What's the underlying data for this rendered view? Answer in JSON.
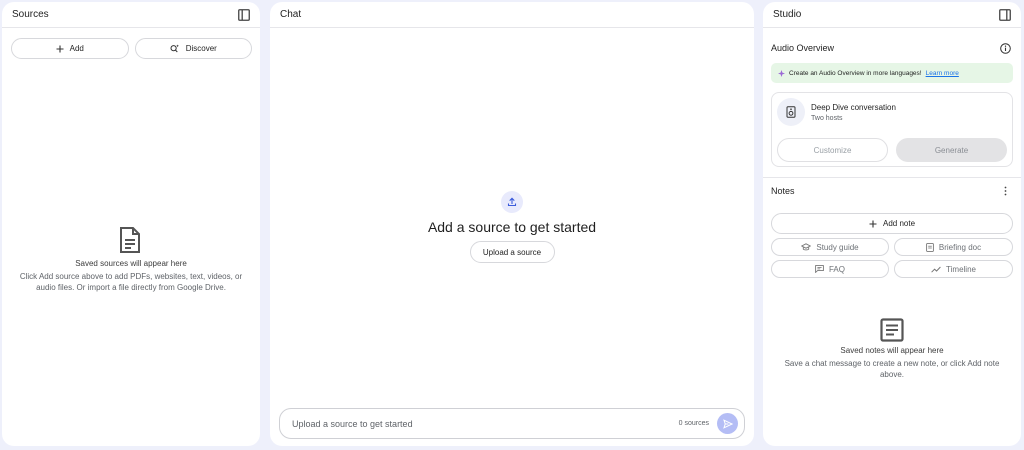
{
  "sources": {
    "title": "Sources",
    "add_label": "Add",
    "discover_label": "Discover",
    "empty_title": "Saved sources will appear here",
    "empty_desc": "Click Add source above to add PDFs, websites, text, videos, or audio files. Or import a file directly from Google Drive."
  },
  "chat": {
    "title": "Chat",
    "heading": "Add a source to get started",
    "upload_label": "Upload a source",
    "input_placeholder": "Upload a source to get started",
    "source_count": "0 sources"
  },
  "studio": {
    "title": "Studio",
    "audio_title": "Audio Overview",
    "promo_text": "Create an Audio Overview in more languages!",
    "promo_link": "Learn more",
    "dd_title": "Deep Dive conversation",
    "dd_sub": "Two hosts",
    "customize_label": "Customize",
    "generate_label": "Generate",
    "notes_title": "Notes",
    "add_note_label": "Add note",
    "note_buttons": [
      "Study guide",
      "Briefing doc",
      "FAQ",
      "Timeline"
    ],
    "empty_title": "Saved notes will appear here",
    "empty_desc": "Save a chat message to create a new note, or click Add note above."
  },
  "colors": {
    "page_bg": "#eef0fb",
    "accent": "#1a73e8",
    "send_button": "#b4bdf5",
    "promo_bg": "#e6f6e6"
  },
  "icons": [
    "panel-toggle-icon",
    "plus-icon",
    "discover-icon",
    "document-icon",
    "upload-icon",
    "send-icon",
    "info-icon",
    "sparkle-icon",
    "speaker-icon",
    "more-vert-icon",
    "study-guide-icon",
    "briefing-doc-icon",
    "faq-icon",
    "timeline-icon",
    "notes-icon"
  ]
}
